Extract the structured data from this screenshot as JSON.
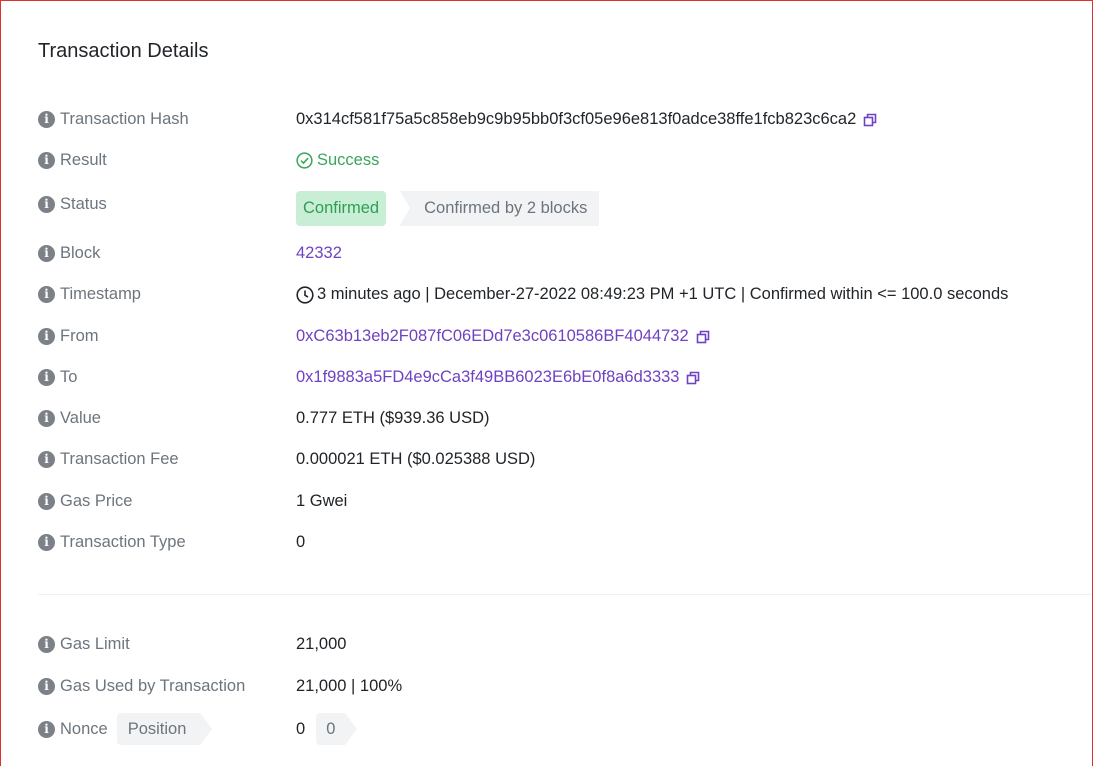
{
  "card": {
    "title": "Transaction Details"
  },
  "rows": {
    "hash": {
      "label": "Transaction Hash",
      "value": "0x314cf581f75a5c858eb9c9b95bb0f3cf05e96e813f0adce38ffe1fcb823c6ca2"
    },
    "result": {
      "label": "Result",
      "value": "Success"
    },
    "status": {
      "label": "Status",
      "badge": "Confirmed",
      "detail": "Confirmed by 2 blocks"
    },
    "block": {
      "label": "Block",
      "value": "42332"
    },
    "timestamp": {
      "label": "Timestamp",
      "value": "3 minutes ago | December-27-2022 08:49:23 PM +1 UTC | Confirmed within <= 100.0 seconds"
    },
    "from": {
      "label": "From",
      "value": "0xC63b13eb2F087fC06EDd7e3c0610586BF4044732"
    },
    "to": {
      "label": "To",
      "value": "0x1f9883a5FD4e9cCa3f49BB6023E6bE0f8a6d3333"
    },
    "value": {
      "label": "Value",
      "value": "0.777 ETH ($939.36 USD)"
    },
    "fee": {
      "label": "Transaction Fee",
      "value": "0.000021 ETH ($0.025388 USD)"
    },
    "gas_price": {
      "label": "Gas Price",
      "value": "1 Gwei"
    },
    "tx_type": {
      "label": "Transaction Type",
      "value": "0"
    },
    "gas_limit": {
      "label": "Gas Limit",
      "value": "21,000"
    },
    "gas_used": {
      "label": "Gas Used by Transaction",
      "value": "21,000 | 100%"
    },
    "nonce": {
      "label": "Nonce",
      "position_label": "Position",
      "value": "0",
      "position_value": "0"
    }
  },
  "icons": {
    "info": "info-icon",
    "copy": "copy-icon",
    "success": "check-circle-icon",
    "clock": "clock-icon"
  },
  "colors": {
    "link": "#6f42c1",
    "success": "#3aa55d",
    "badge_bg": "#c9eed6",
    "label": "#6c757d"
  }
}
